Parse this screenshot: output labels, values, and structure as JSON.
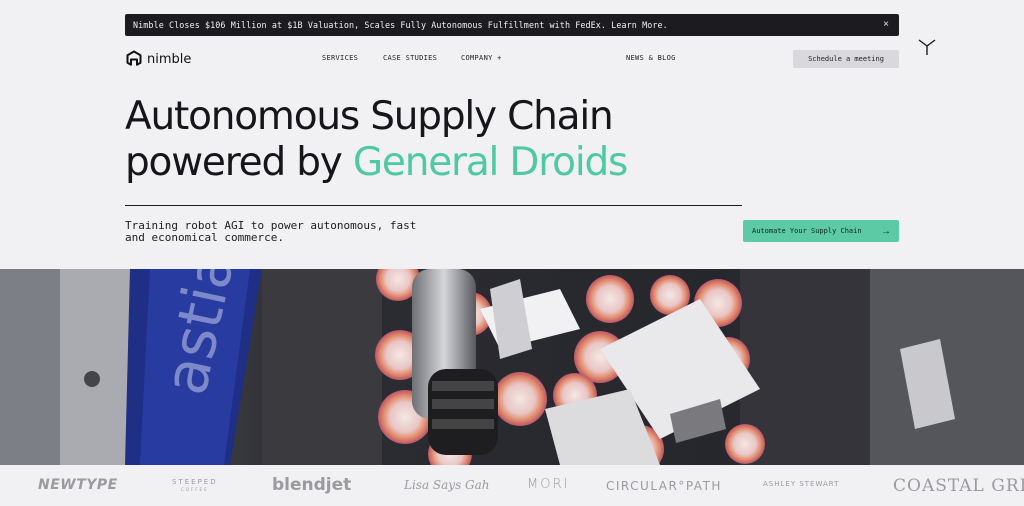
{
  "announcement": {
    "text": "Nimble Closes $106 Million at $1B Valuation, Scales Fully Autonomous Fulfillment with FedEx. Learn More.",
    "close_label": "×"
  },
  "brand": {
    "name": "nimble"
  },
  "nav": {
    "services": "SERVICES",
    "case_studies": "CASE STUDIES",
    "company": "COMPANY +",
    "news": "NEWS & BLOG",
    "meeting_button": "Schedule a meeting"
  },
  "hero": {
    "title_line1": "Autonomous Supply Chain",
    "title_line2_prefix": "powered by ",
    "title_line2_accent": "General Droids",
    "subtitle": "Training robot AGI to power autonomous, fast and economical commerce.",
    "cta_label": "Automate Your Supply Chain",
    "cta_arrow": "→"
  },
  "colors": {
    "accent": "#4ec9a0",
    "cta_bg": "#5ccaa5",
    "dark": "#1c1c20"
  },
  "partners": {
    "newtype": "NEWTYPE",
    "steeped": "STEEPED",
    "steeped_sub": "COFFEE",
    "blendjet": "blendjet",
    "lisa": "Lisa Says Gah",
    "mori": "MORI",
    "circular": "CIRCULAR°PATH",
    "ashley": "ASHLEY   STEWART",
    "coastal": "COASTAL GRL"
  }
}
